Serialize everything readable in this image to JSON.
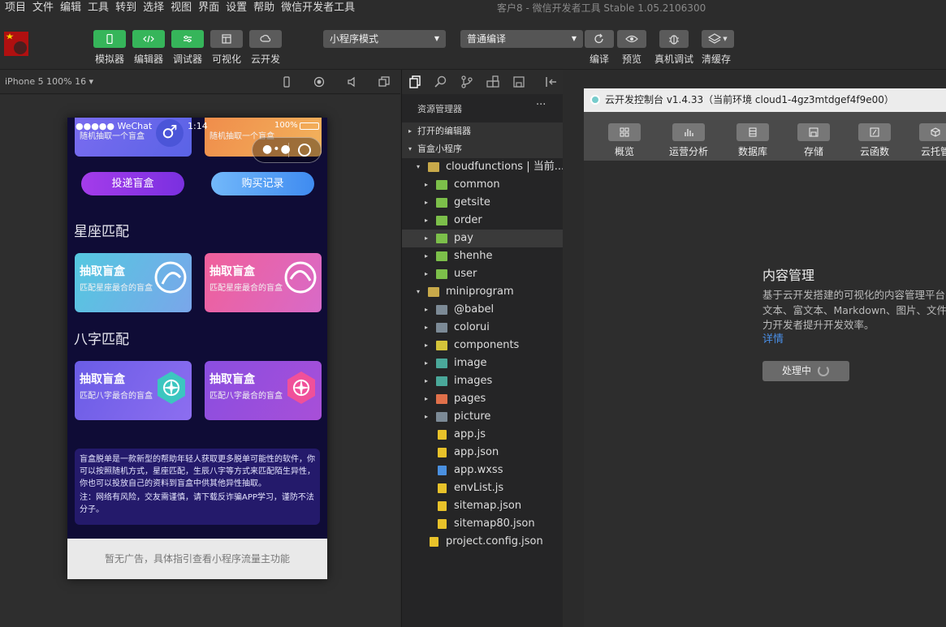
{
  "menu": {
    "items": [
      "项目",
      "文件",
      "编辑",
      "工具",
      "转到",
      "选择",
      "视图",
      "界面",
      "设置",
      "帮助",
      "微信开发者工具"
    ],
    "window_title": "客户8 - 微信开发者工具 Stable 1.05.2106300"
  },
  "toolbar": {
    "simulator": "模拟器",
    "editor": "编辑器",
    "debugger": "调试器",
    "visual": "可视化",
    "cloud": "云开发",
    "mode_select": "小程序模式",
    "compile_select": "普通编译",
    "compile": "编译",
    "preview": "预览",
    "real_debug": "真机调试",
    "clear_cache": "清缓存"
  },
  "simulator": {
    "device": "iPhone 5 100% 16 ▾",
    "status": {
      "carrier": "●●●●● WeChat",
      "time": "1:14",
      "battery": "100%"
    },
    "cards_top": [
      {
        "sub": "随机抽取一个盲盒"
      },
      {
        "sub": "随机抽取一个盲盒"
      }
    ],
    "buttons": {
      "deliver": "投递盲盒",
      "records": "购买记录"
    },
    "section1": "星座匹配",
    "section1_cards": [
      {
        "title": "抽取盲盒",
        "sub": "匹配星座最合的盲盒"
      },
      {
        "title": "抽取盲盒",
        "sub": "匹配星座最合的盲盒"
      }
    ],
    "section2": "八字匹配",
    "section2_cards": [
      {
        "title": "抽取盲盒",
        "sub": "匹配八字最合的盲盒"
      },
      {
        "title": "抽取盲盒",
        "sub": "匹配八字最合的盲盒"
      }
    ],
    "desc1": "盲盒脱单是一款新型的帮助年轻人获取更多脱单可能性的软件，你可以按照随机方式，星座匹配，生辰八字等方式来匹配陌生异性，你也可以投放自己的资料到盲盒中供其他异性抽取。",
    "desc2": "注：网络有风险，交友需谨慎，请下载反诈骗APP学习，谨防不法分子。",
    "ad": "暂无广告，具体指引查看小程序流量主功能"
  },
  "explorer": {
    "title": "资源管理器",
    "more": "···",
    "open_editors": "打开的编辑器",
    "project": "盲盒小程序",
    "tree": [
      {
        "label": "cloudfunctions | 当前...",
        "indent": 1,
        "arrow": "▾",
        "icon": "folder-open"
      },
      {
        "label": "common",
        "indent": 2,
        "arrow": "▸",
        "icon": "cloud-folder"
      },
      {
        "label": "getsite",
        "indent": 2,
        "arrow": "▸",
        "icon": "cloud-folder"
      },
      {
        "label": "order",
        "indent": 2,
        "arrow": "▸",
        "icon": "cloud-folder"
      },
      {
        "label": "pay",
        "indent": 2,
        "arrow": "▸",
        "icon": "cloud-folder",
        "selected": true
      },
      {
        "label": "shenhe",
        "indent": 2,
        "arrow": "▸",
        "icon": "cloud-folder"
      },
      {
        "label": "user",
        "indent": 2,
        "arrow": "▸",
        "icon": "cloud-folder"
      },
      {
        "label": "miniprogram",
        "indent": 1,
        "arrow": "▾",
        "icon": "folder-open"
      },
      {
        "label": "@babel",
        "indent": 2,
        "arrow": "▸",
        "icon": "folder"
      },
      {
        "label": "colorui",
        "indent": 2,
        "arrow": "▸",
        "icon": "folder"
      },
      {
        "label": "components",
        "indent": 2,
        "arrow": "▸",
        "icon": "components-folder"
      },
      {
        "label": "image",
        "indent": 2,
        "arrow": "▸",
        "icon": "image-folder"
      },
      {
        "label": "images",
        "indent": 2,
        "arrow": "▸",
        "icon": "image-folder"
      },
      {
        "label": "pages",
        "indent": 2,
        "arrow": "▸",
        "icon": "pages-folder"
      },
      {
        "label": "picture",
        "indent": 2,
        "arrow": "▸",
        "icon": "folder"
      },
      {
        "label": "app.js",
        "indent": 2,
        "arrow": "",
        "icon": "js-file"
      },
      {
        "label": "app.json",
        "indent": 2,
        "arrow": "",
        "icon": "json-file"
      },
      {
        "label": "app.wxss",
        "indent": 2,
        "arrow": "",
        "icon": "wxss-file"
      },
      {
        "label": "envList.js",
        "indent": 2,
        "arrow": "",
        "icon": "js-file"
      },
      {
        "label": "sitemap.json",
        "indent": 2,
        "arrow": "",
        "icon": "json-file"
      },
      {
        "label": "sitemap80.json",
        "indent": 2,
        "arrow": "",
        "icon": "json-file"
      },
      {
        "label": "project.config.json",
        "indent": 1,
        "arrow": "",
        "icon": "json-file"
      }
    ]
  },
  "cloud": {
    "title": "云开发控制台 v1.4.33（当前环境 cloud1-4gz3mtdgef4f9e00）",
    "tabs": [
      "概览",
      "运营分析",
      "数据库",
      "存储",
      "云函数",
      "云托管"
    ],
    "cm_title": "内容管理",
    "cm_lines": [
      "基于云开发搭建的可视化的内容管理平台",
      "文本、富文本、Markdown、图片、文件",
      "力开发者提升开发效率。"
    ],
    "cm_link": "详情",
    "cm_btn": "处理中"
  },
  "colors": {
    "accent_green": "#36b55a",
    "link_blue": "#4a8fe7",
    "phone_bg": "#0f0c36"
  }
}
